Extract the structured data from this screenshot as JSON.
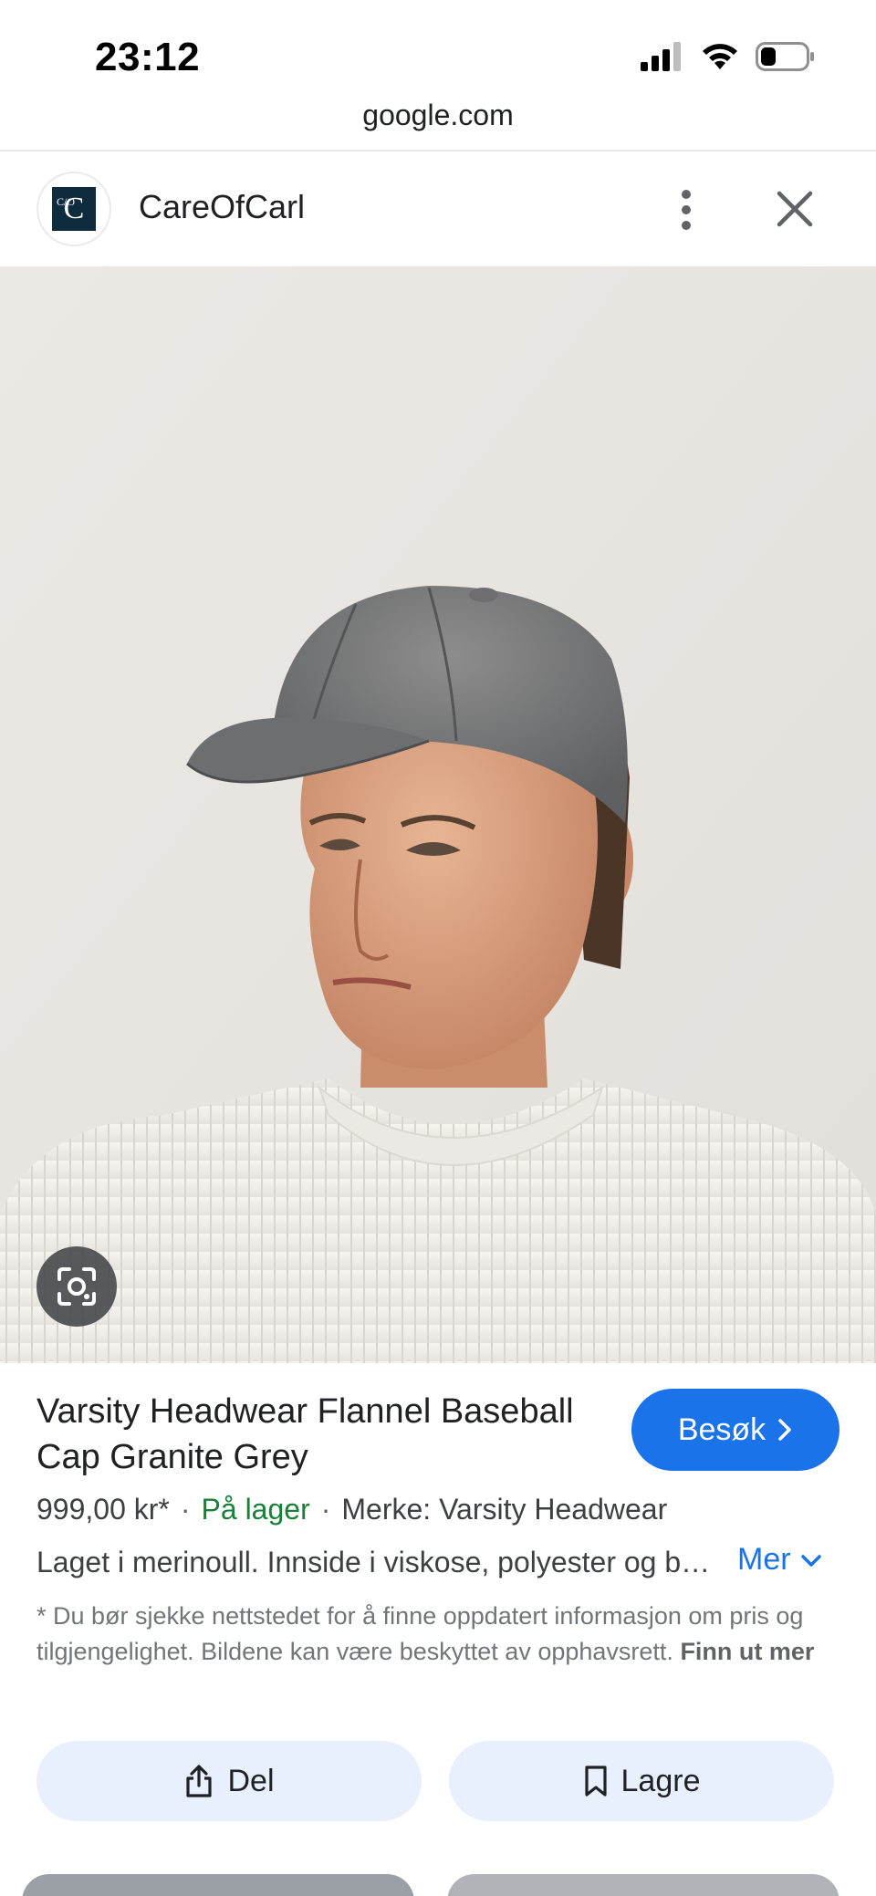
{
  "status_bar": {
    "time": "23:12",
    "icons": [
      "cellular-icon",
      "wifi-icon",
      "battery-icon"
    ]
  },
  "browser": {
    "url": "google.com"
  },
  "header": {
    "site_name": "CareOfCarl",
    "logo_text": "C",
    "logo_small": "C/O"
  },
  "product": {
    "title": "Varsity Headwear Flannel Baseball Cap Granite Grey",
    "price": "999,00 kr*",
    "stock": "På lager",
    "brand": "Merke: Varsity Headwear",
    "description": "Laget i merinoull. Innside i viskose, polyester og bomull.",
    "more_label": "Mer",
    "visit_label": "Besøk",
    "disclaimer": "* Du bør sjekke nettstedet for å finne oppdatert informasjon om pris og tilgjengelighet. Bildene kan være beskyttet av opphavsrett.",
    "learn_more": "Finn ut mer"
  },
  "actions": {
    "share_label": "Del",
    "save_label": "Lagre"
  },
  "colors": {
    "accent": "#1a73e8",
    "stock_green": "#188038",
    "chip_bg": "#e8f0fe"
  }
}
